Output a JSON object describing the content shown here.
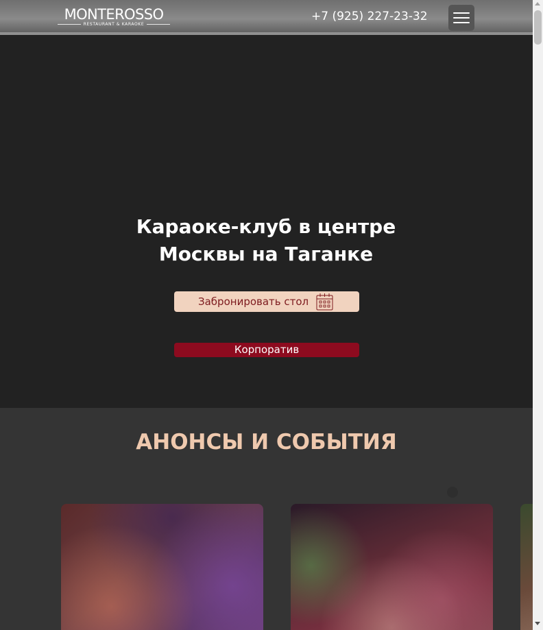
{
  "header": {
    "logo_text": "MONTEROSSO",
    "logo_subtext": "RESTAURANT & KARAOKE",
    "phone": "+7 (925) 227-23-32",
    "menu_icon": "burger-menu-icon"
  },
  "hero": {
    "title_line1": "Караоке-клуб в центре",
    "title_line2": "Москвы на Таганке",
    "book_button_label": "Забронировать стол",
    "book_button_icon": "calendar-icon",
    "corporate_button_label": "Корпоратив"
  },
  "events": {
    "title": "АНОНСЫ И СОБЫТИЯ"
  },
  "colors": {
    "accent_beige": "#f1d3bf",
    "accent_red": "#8d0b1f",
    "title_beige": "#efc9ae",
    "dark_bg": "#222222"
  }
}
